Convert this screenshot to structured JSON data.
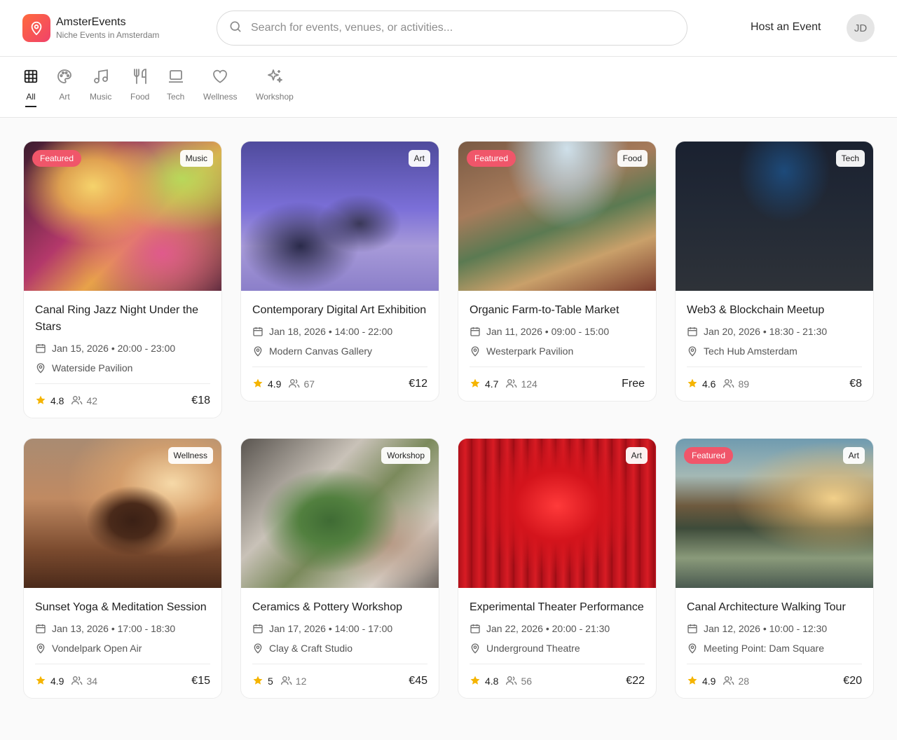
{
  "header": {
    "app_name": "AmsterEvents",
    "tagline": "Niche Events in Amsterdam",
    "search_placeholder": "Search for events, venues, or activities...",
    "host_label": "Host an Event",
    "user_initials": "JD"
  },
  "categories": [
    {
      "label": "All",
      "icon": "grid-icon",
      "active": true
    },
    {
      "label": "Art",
      "icon": "palette-icon"
    },
    {
      "label": "Music",
      "icon": "music-note-icon"
    },
    {
      "label": "Food",
      "icon": "utensils-icon"
    },
    {
      "label": "Tech",
      "icon": "laptop-icon"
    },
    {
      "label": "Wellness",
      "icon": "heart-icon"
    },
    {
      "label": "Workshop",
      "icon": "sparkles-icon"
    }
  ],
  "events": [
    {
      "title": "Canal Ring Jazz Night Under the Stars",
      "featured": "Featured",
      "category": "Music",
      "date": "Jan 15, 2026 • 20:00 - 23:00",
      "venue": "Waterside Pavilion",
      "rating": "4.8",
      "attendees": "42",
      "price": "€18"
    },
    {
      "title": "Contemporary Digital Art Exhibition",
      "category": "Art",
      "date": "Jan 18, 2026 • 14:00 - 22:00",
      "venue": "Modern Canvas Gallery",
      "rating": "4.9",
      "attendees": "67",
      "price": "€12"
    },
    {
      "title": "Organic Farm-to-Table Market",
      "featured": "Featured",
      "category": "Food",
      "date": "Jan 11, 2026 • 09:00 - 15:00",
      "venue": "Westerpark Pavilion",
      "rating": "4.7",
      "attendees": "124",
      "price": "Free"
    },
    {
      "title": "Web3 & Blockchain Meetup",
      "category": "Tech",
      "date": "Jan 20, 2026 • 18:30 - 21:30",
      "venue": "Tech Hub Amsterdam",
      "rating": "4.6",
      "attendees": "89",
      "price": "€8"
    },
    {
      "title": "Sunset Yoga & Meditation Session",
      "category": "Wellness",
      "date": "Jan 13, 2026 • 17:00 - 18:30",
      "venue": "Vondelpark Open Air",
      "rating": "4.9",
      "attendees": "34",
      "price": "€15"
    },
    {
      "title": "Ceramics & Pottery Workshop",
      "category": "Workshop",
      "date": "Jan 17, 2026 • 14:00 - 17:00",
      "venue": "Clay & Craft Studio",
      "rating": "5",
      "attendees": "12",
      "price": "€45"
    },
    {
      "title": "Experimental Theater Performance",
      "category": "Art",
      "date": "Jan 22, 2026 • 20:00 - 21:30",
      "venue": "Underground Theatre",
      "rating": "4.8",
      "attendees": "56",
      "price": "€22"
    },
    {
      "title": "Canal Architecture Walking Tour",
      "featured": "Featured",
      "category": "Art",
      "date": "Jan 12, 2026 • 10:00 - 12:30",
      "venue": "Meeting Point: Dam Square",
      "rating": "4.9",
      "attendees": "28",
      "price": "€20"
    }
  ]
}
